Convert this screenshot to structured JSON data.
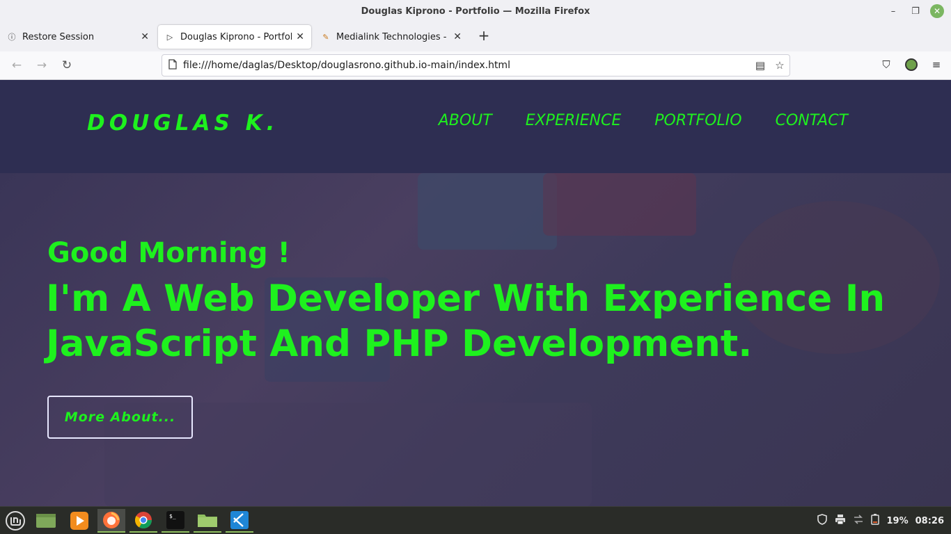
{
  "window": {
    "title": "Douglas Kiprono - Portfolio — Mozilla Firefox",
    "controls": {
      "minimize": "–",
      "maximize": "❐",
      "close": "✕"
    }
  },
  "tabs": [
    {
      "label": "Restore Session",
      "icon": "info-icon",
      "glyph": "ⓘ",
      "close": "✕"
    },
    {
      "label": "Douglas Kiprono - Portfolio",
      "icon": "play-icon",
      "glyph": "▷",
      "close": "✕",
      "active": true
    },
    {
      "label": "Medialink Technologies - Be",
      "icon": "medialink-favicon",
      "glyph": "✎",
      "close": "✕"
    }
  ],
  "new_tab": "+",
  "nav": {
    "back": "←",
    "forward": "→",
    "reload": "↻",
    "url": "file:///home/daglas/Desktop/douglasrono.github.io-main/index.html",
    "reader": "▤",
    "bookmark": "☆",
    "pocket": "⛉",
    "menu": "≡"
  },
  "site": {
    "logo": "DOUGLAS K.",
    "nav_links": [
      "ABOUT",
      "EXPERIENCE",
      "PORTFOLIO",
      "CONTACT"
    ],
    "greeting": "Good Morning !",
    "headline": "I'm A Web Developer With Experience In JavaScript And PHP Development.",
    "button": "More About..."
  },
  "taskbar": {
    "tray": {
      "battery": "19%",
      "time": "08:26"
    }
  },
  "colors": {
    "accent_green": "#1ef11e",
    "header_bg": "#2e2e52",
    "taskbar_bg": "#2a2c28"
  }
}
